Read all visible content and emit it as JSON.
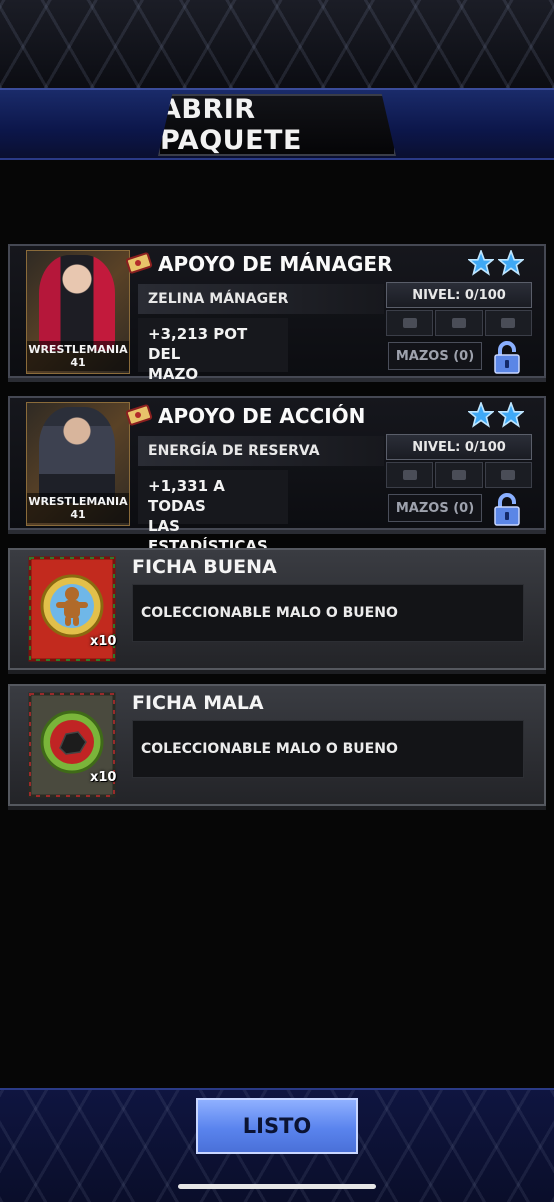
{
  "header": {
    "title": "ABRIR PAQUETE"
  },
  "cards": [
    {
      "title": "APOYO DE MÁNAGER",
      "subtitle": "ZELINA MÁNAGER",
      "description_line1": "+3,213 POT DEL",
      "description_line2": "MAZO",
      "level": "NIVEL: 0/100",
      "decks": "MAZOS (0)",
      "art_label": "WRESTLEMANIA 41",
      "stars": 2
    },
    {
      "title": "APOYO DE ACCIÓN",
      "subtitle": "ENERGÍA DE RESERVA",
      "description_line1": "+1,331 A TODAS",
      "description_line2": "LAS ESTADÍSTICAS",
      "level": "NIVEL: 0/100",
      "decks": "MAZOS (0)",
      "art_label": "WRESTLEMANIA 41",
      "stars": 2
    }
  ],
  "tokens": [
    {
      "title": "FICHA BUENA",
      "description": "COLECCIONABLE MALO O BUENO",
      "count": "x10",
      "icon": "gingerbread-icon"
    },
    {
      "title": "FICHA MALA",
      "description": "COLECCIONABLE MALO O BUENO",
      "count": "x10",
      "icon": "coal-icon"
    }
  ],
  "footer": {
    "done_label": "LISTO"
  },
  "colors": {
    "accent_blue": "#5a84ee",
    "star_blue": "#3fa9f5",
    "lock_blue": "#5b86e6"
  }
}
